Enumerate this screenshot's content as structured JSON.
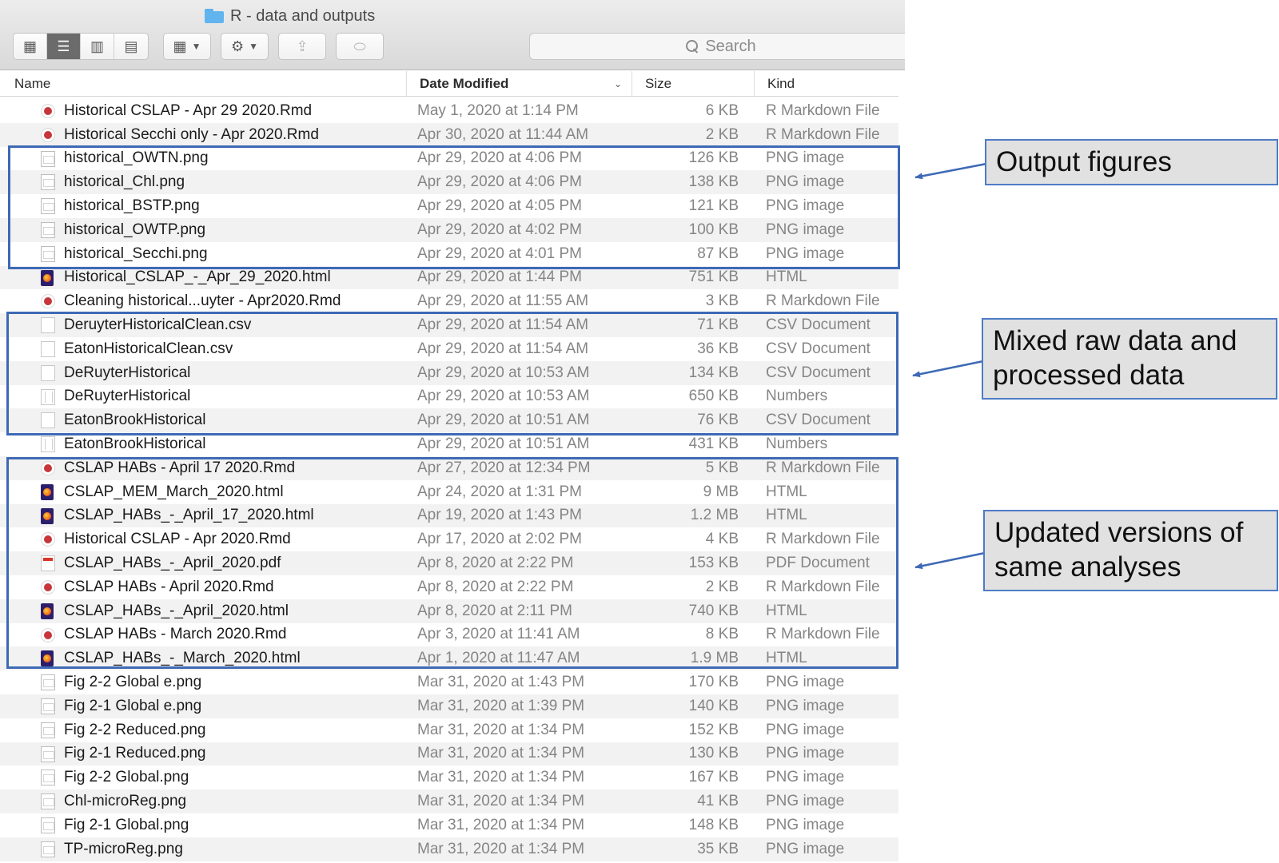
{
  "window": {
    "title": "R - data and outputs"
  },
  "toolbar": {
    "view_icons": [
      "icon-view-icon",
      "list-view-icon",
      "column-view-icon",
      "gallery-view-icon"
    ],
    "search_placeholder": "Search"
  },
  "columns": {
    "name": "Name",
    "date": "Date Modified",
    "size": "Size",
    "kind": "Kind"
  },
  "files": [
    {
      "name": "Historical CSLAP - Apr 29 2020.Rmd",
      "date": "May 1, 2020 at 1:14 PM",
      "size": "6 KB",
      "kind": "R Markdown File",
      "icon": "rmd"
    },
    {
      "name": "Historical Secchi only - Apr 2020.Rmd",
      "date": "Apr 30, 2020 at 11:44 AM",
      "size": "2 KB",
      "kind": "R Markdown File",
      "icon": "rmd"
    },
    {
      "name": "historical_OWTN.png",
      "date": "Apr 29, 2020 at 4:06 PM",
      "size": "126 KB",
      "kind": "PNG image",
      "icon": "png"
    },
    {
      "name": "historical_Chl.png",
      "date": "Apr 29, 2020 at 4:06 PM",
      "size": "138 KB",
      "kind": "PNG image",
      "icon": "png"
    },
    {
      "name": "historical_BSTP.png",
      "date": "Apr 29, 2020 at 4:05 PM",
      "size": "121 KB",
      "kind": "PNG image",
      "icon": "png"
    },
    {
      "name": "historical_OWTP.png",
      "date": "Apr 29, 2020 at 4:02 PM",
      "size": "100 KB",
      "kind": "PNG image",
      "icon": "png"
    },
    {
      "name": "historical_Secchi.png",
      "date": "Apr 29, 2020 at 4:01 PM",
      "size": "87 KB",
      "kind": "PNG image",
      "icon": "png"
    },
    {
      "name": "Historical_CSLAP_-_Apr_29_2020.html",
      "date": "Apr 29, 2020 at 1:44 PM",
      "size": "751 KB",
      "kind": "HTML",
      "icon": "html"
    },
    {
      "name": "Cleaning historical...uyter - Apr2020.Rmd",
      "date": "Apr 29, 2020 at 11:55 AM",
      "size": "3 KB",
      "kind": "R Markdown File",
      "icon": "rmd"
    },
    {
      "name": "DeruyterHistoricalClean.csv",
      "date": "Apr 29, 2020 at 11:54 AM",
      "size": "71 KB",
      "kind": "CSV Document",
      "icon": "csv"
    },
    {
      "name": "EatonHistoricalClean.csv",
      "date": "Apr 29, 2020 at 11:54 AM",
      "size": "36 KB",
      "kind": "CSV Document",
      "icon": "csv"
    },
    {
      "name": "DeRuyterHistorical",
      "date": "Apr 29, 2020 at 10:53 AM",
      "size": "134 KB",
      "kind": "CSV Document",
      "icon": "csv"
    },
    {
      "name": "DeRuyterHistorical",
      "date": "Apr 29, 2020 at 10:53 AM",
      "size": "650 KB",
      "kind": "Numbers",
      "icon": "numbers"
    },
    {
      "name": "EatonBrookHistorical",
      "date": "Apr 29, 2020 at 10:51 AM",
      "size": "76 KB",
      "kind": "CSV Document",
      "icon": "csv"
    },
    {
      "name": "EatonBrookHistorical",
      "date": "Apr 29, 2020 at 10:51 AM",
      "size": "431 KB",
      "kind": "Numbers",
      "icon": "numbers"
    },
    {
      "name": "CSLAP HABs - April 17 2020.Rmd",
      "date": "Apr 27, 2020 at 12:34 PM",
      "size": "5 KB",
      "kind": "R Markdown File",
      "icon": "rmd"
    },
    {
      "name": "CSLAP_MEM_March_2020.html",
      "date": "Apr 24, 2020 at 1:31 PM",
      "size": "9 MB",
      "kind": "HTML",
      "icon": "html"
    },
    {
      "name": "CSLAP_HABs_-_April_17_2020.html",
      "date": "Apr 19, 2020 at 1:43 PM",
      "size": "1.2 MB",
      "kind": "HTML",
      "icon": "html"
    },
    {
      "name": "Historical CSLAP - Apr 2020.Rmd",
      "date": "Apr 17, 2020 at 2:02 PM",
      "size": "4 KB",
      "kind": "R Markdown File",
      "icon": "rmd"
    },
    {
      "name": "CSLAP_HABs_-_April_2020.pdf",
      "date": "Apr 8, 2020 at 2:22 PM",
      "size": "153 KB",
      "kind": "PDF Document",
      "icon": "pdf"
    },
    {
      "name": "CSLAP HABs - April 2020.Rmd",
      "date": "Apr 8, 2020 at 2:22 PM",
      "size": "2 KB",
      "kind": "R Markdown File",
      "icon": "rmd"
    },
    {
      "name": "CSLAP_HABs_-_April_2020.html",
      "date": "Apr 8, 2020 at 2:11 PM",
      "size": "740 KB",
      "kind": "HTML",
      "icon": "html"
    },
    {
      "name": "CSLAP HABs - March 2020.Rmd",
      "date": "Apr 3, 2020 at 11:41 AM",
      "size": "8 KB",
      "kind": "R Markdown File",
      "icon": "rmd"
    },
    {
      "name": "CSLAP_HABs_-_March_2020.html",
      "date": "Apr 1, 2020 at 11:47 AM",
      "size": "1.9 MB",
      "kind": "HTML",
      "icon": "html"
    },
    {
      "name": "Fig 2-2 Global e.png",
      "date": "Mar 31, 2020 at 1:43 PM",
      "size": "170 KB",
      "kind": "PNG image",
      "icon": "png"
    },
    {
      "name": "Fig 2-1 Global e.png",
      "date": "Mar 31, 2020 at 1:39 PM",
      "size": "140 KB",
      "kind": "PNG image",
      "icon": "png"
    },
    {
      "name": "Fig 2-2 Reduced.png",
      "date": "Mar 31, 2020 at 1:34 PM",
      "size": "152 KB",
      "kind": "PNG image",
      "icon": "png"
    },
    {
      "name": "Fig 2-1 Reduced.png",
      "date": "Mar 31, 2020 at 1:34 PM",
      "size": "130 KB",
      "kind": "PNG image",
      "icon": "png"
    },
    {
      "name": "Fig 2-2 Global.png",
      "date": "Mar 31, 2020 at 1:34 PM",
      "size": "167 KB",
      "kind": "PNG image",
      "icon": "png"
    },
    {
      "name": "Chl-microReg.png",
      "date": "Mar 31, 2020 at 1:34 PM",
      "size": "41 KB",
      "kind": "PNG image",
      "icon": "png"
    },
    {
      "name": "Fig 2-1 Global.png",
      "date": "Mar 31, 2020 at 1:34 PM",
      "size": "148 KB",
      "kind": "PNG image",
      "icon": "png"
    },
    {
      "name": "TP-microReg.png",
      "date": "Mar 31, 2020 at 1:34 PM",
      "size": "35 KB",
      "kind": "PNG image",
      "icon": "png"
    }
  ],
  "annotations": {
    "output_figures": "Output figures",
    "mixed_data": "Mixed raw data and processed data",
    "updated_versions": "Updated versions of same analyses",
    "color": "#3e69b6"
  }
}
